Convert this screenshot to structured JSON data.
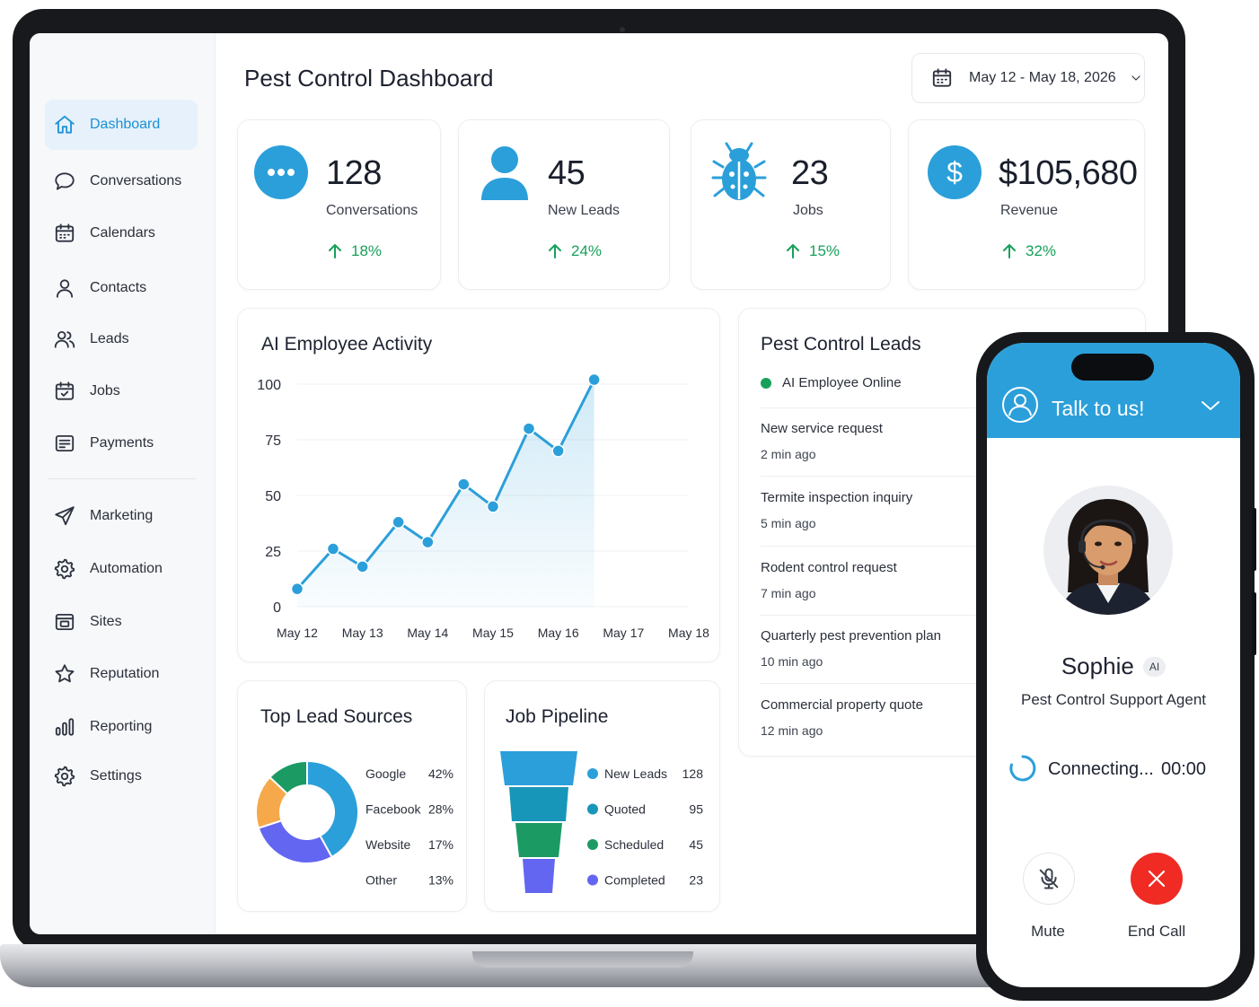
{
  "dashboard": {
    "title": "Pest Control Dashboard",
    "date_range": "May 12 - May 18, 2026"
  },
  "sidebar": {
    "items": [
      {
        "label": "Dashboard",
        "icon": "home-icon",
        "active": true
      },
      {
        "label": "Conversations",
        "icon": "chat-bubble-icon"
      },
      {
        "label": "Calendars",
        "icon": "calendar-icon"
      },
      {
        "label": "Contacts",
        "icon": "user-icon"
      },
      {
        "label": "Leads",
        "icon": "users-icon"
      },
      {
        "label": "Jobs",
        "icon": "calendar-check-icon"
      },
      {
        "label": "Payments",
        "icon": "receipt-icon"
      },
      {
        "label": "Marketing",
        "icon": "paper-plane-icon"
      },
      {
        "label": "Automation",
        "icon": "gear-icon"
      },
      {
        "label": "Sites",
        "icon": "browser-icon"
      },
      {
        "label": "Reputation",
        "icon": "star-icon"
      },
      {
        "label": "Reporting",
        "icon": "bar-chart-icon"
      },
      {
        "label": "Settings",
        "icon": "settings-icon"
      }
    ]
  },
  "stats": [
    {
      "value": "128",
      "label": "Conversations",
      "change": "18%",
      "icon": "chat-dots-icon"
    },
    {
      "value": "45",
      "label": "New Leads",
      "change": "24%",
      "icon": "person-icon"
    },
    {
      "value": "23",
      "label": "Jobs",
      "change": "15%",
      "icon": "bug-icon"
    },
    {
      "value": "$105,680",
      "label": "Revenue",
      "change": "32%",
      "icon": "dollar-icon"
    }
  ],
  "activity": {
    "title": "AI Employee Activity"
  },
  "chart_data": [
    {
      "type": "area",
      "title": "AI Employee Activity",
      "x": [
        "May 12",
        "May 13",
        "May 14",
        "May 15",
        "May 16",
        "May 17",
        "May 18"
      ],
      "y_ticks": [
        0,
        25,
        50,
        75,
        100
      ],
      "ylim": [
        0,
        100
      ],
      "grid": true,
      "series": [
        {
          "points": [
            [
              "May 12",
              8
            ],
            [
              null,
              26
            ],
            [
              "May 13",
              18
            ],
            [
              null,
              38
            ],
            [
              "May 14",
              29
            ],
            [
              null,
              55
            ],
            [
              "May 15",
              45
            ],
            [
              null,
              80
            ],
            [
              "May 16",
              70
            ],
            [
              null,
              102
            ]
          ]
        }
      ],
      "color": "#2b9fda"
    },
    {
      "type": "pie",
      "title": "Top Lead Sources",
      "donut": true,
      "slices": [
        {
          "label": "Google",
          "percent": "42%",
          "value": 42,
          "color": "#2b9fda"
        },
        {
          "label": "Facebook",
          "percent": "28%",
          "value": 28,
          "color": "#6366f1"
        },
        {
          "label": "Website",
          "percent": "17%",
          "value": 17,
          "color": "#f5a94a"
        },
        {
          "label": "Other",
          "percent": "13%",
          "value": 13,
          "color": "#1c9a64"
        }
      ]
    },
    {
      "type": "bar",
      "title": "Job Pipeline",
      "subtype": "funnel",
      "stages": [
        {
          "label": "New Leads",
          "value": "128",
          "color": "#2b9fda"
        },
        {
          "label": "Quoted",
          "value": "95",
          "color": "#1896b9"
        },
        {
          "label": "Scheduled",
          "value": "45",
          "color": "#1c9a64"
        },
        {
          "label": "Completed",
          "value": "23",
          "color": "#6366f1"
        }
      ]
    }
  ],
  "leads": {
    "title": "Pest Control Leads",
    "status": "AI Employee Online",
    "items": [
      {
        "title": "New service request",
        "time": "2 min ago"
      },
      {
        "title": "Termite inspection inquiry",
        "time": "5 min ago"
      },
      {
        "title": "Rodent control request",
        "time": "7 min ago"
      },
      {
        "title": "Quarterly pest prevention plan",
        "time": "10 min ago"
      },
      {
        "title": "Commercial property quote",
        "time": "12 min ago"
      }
    ]
  },
  "phone": {
    "header": "Talk to us!",
    "agent_name": "Sophie",
    "badge": "AI",
    "agent_role": "Pest Control Support Agent",
    "status": "Connecting...",
    "timer": "00:00",
    "mute_label": "Mute",
    "end_label": "End Call"
  },
  "colors": {
    "accent": "#2b9fda",
    "positive": "#16a05a",
    "end_call": "#ef2b24"
  }
}
